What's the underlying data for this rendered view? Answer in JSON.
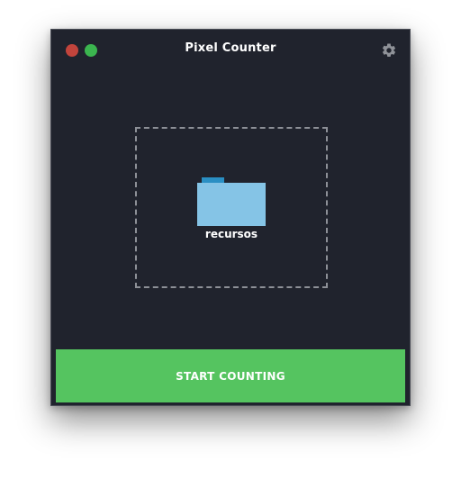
{
  "window": {
    "title": "Pixel Counter",
    "background_color": "#20232d"
  },
  "traffic_lights": {
    "close_color": "#c2443c",
    "zoom_color": "#3bb54f"
  },
  "toolbar": {
    "settings_icon": "gear-icon"
  },
  "dropzone": {
    "folder_icon": "folder-icon",
    "folder_name": "recursos",
    "folder_color": "#85c4e6",
    "folder_tab_color": "#2a8fc3"
  },
  "actions": {
    "start_label": "START COUNTING",
    "start_color": "#55c460"
  }
}
